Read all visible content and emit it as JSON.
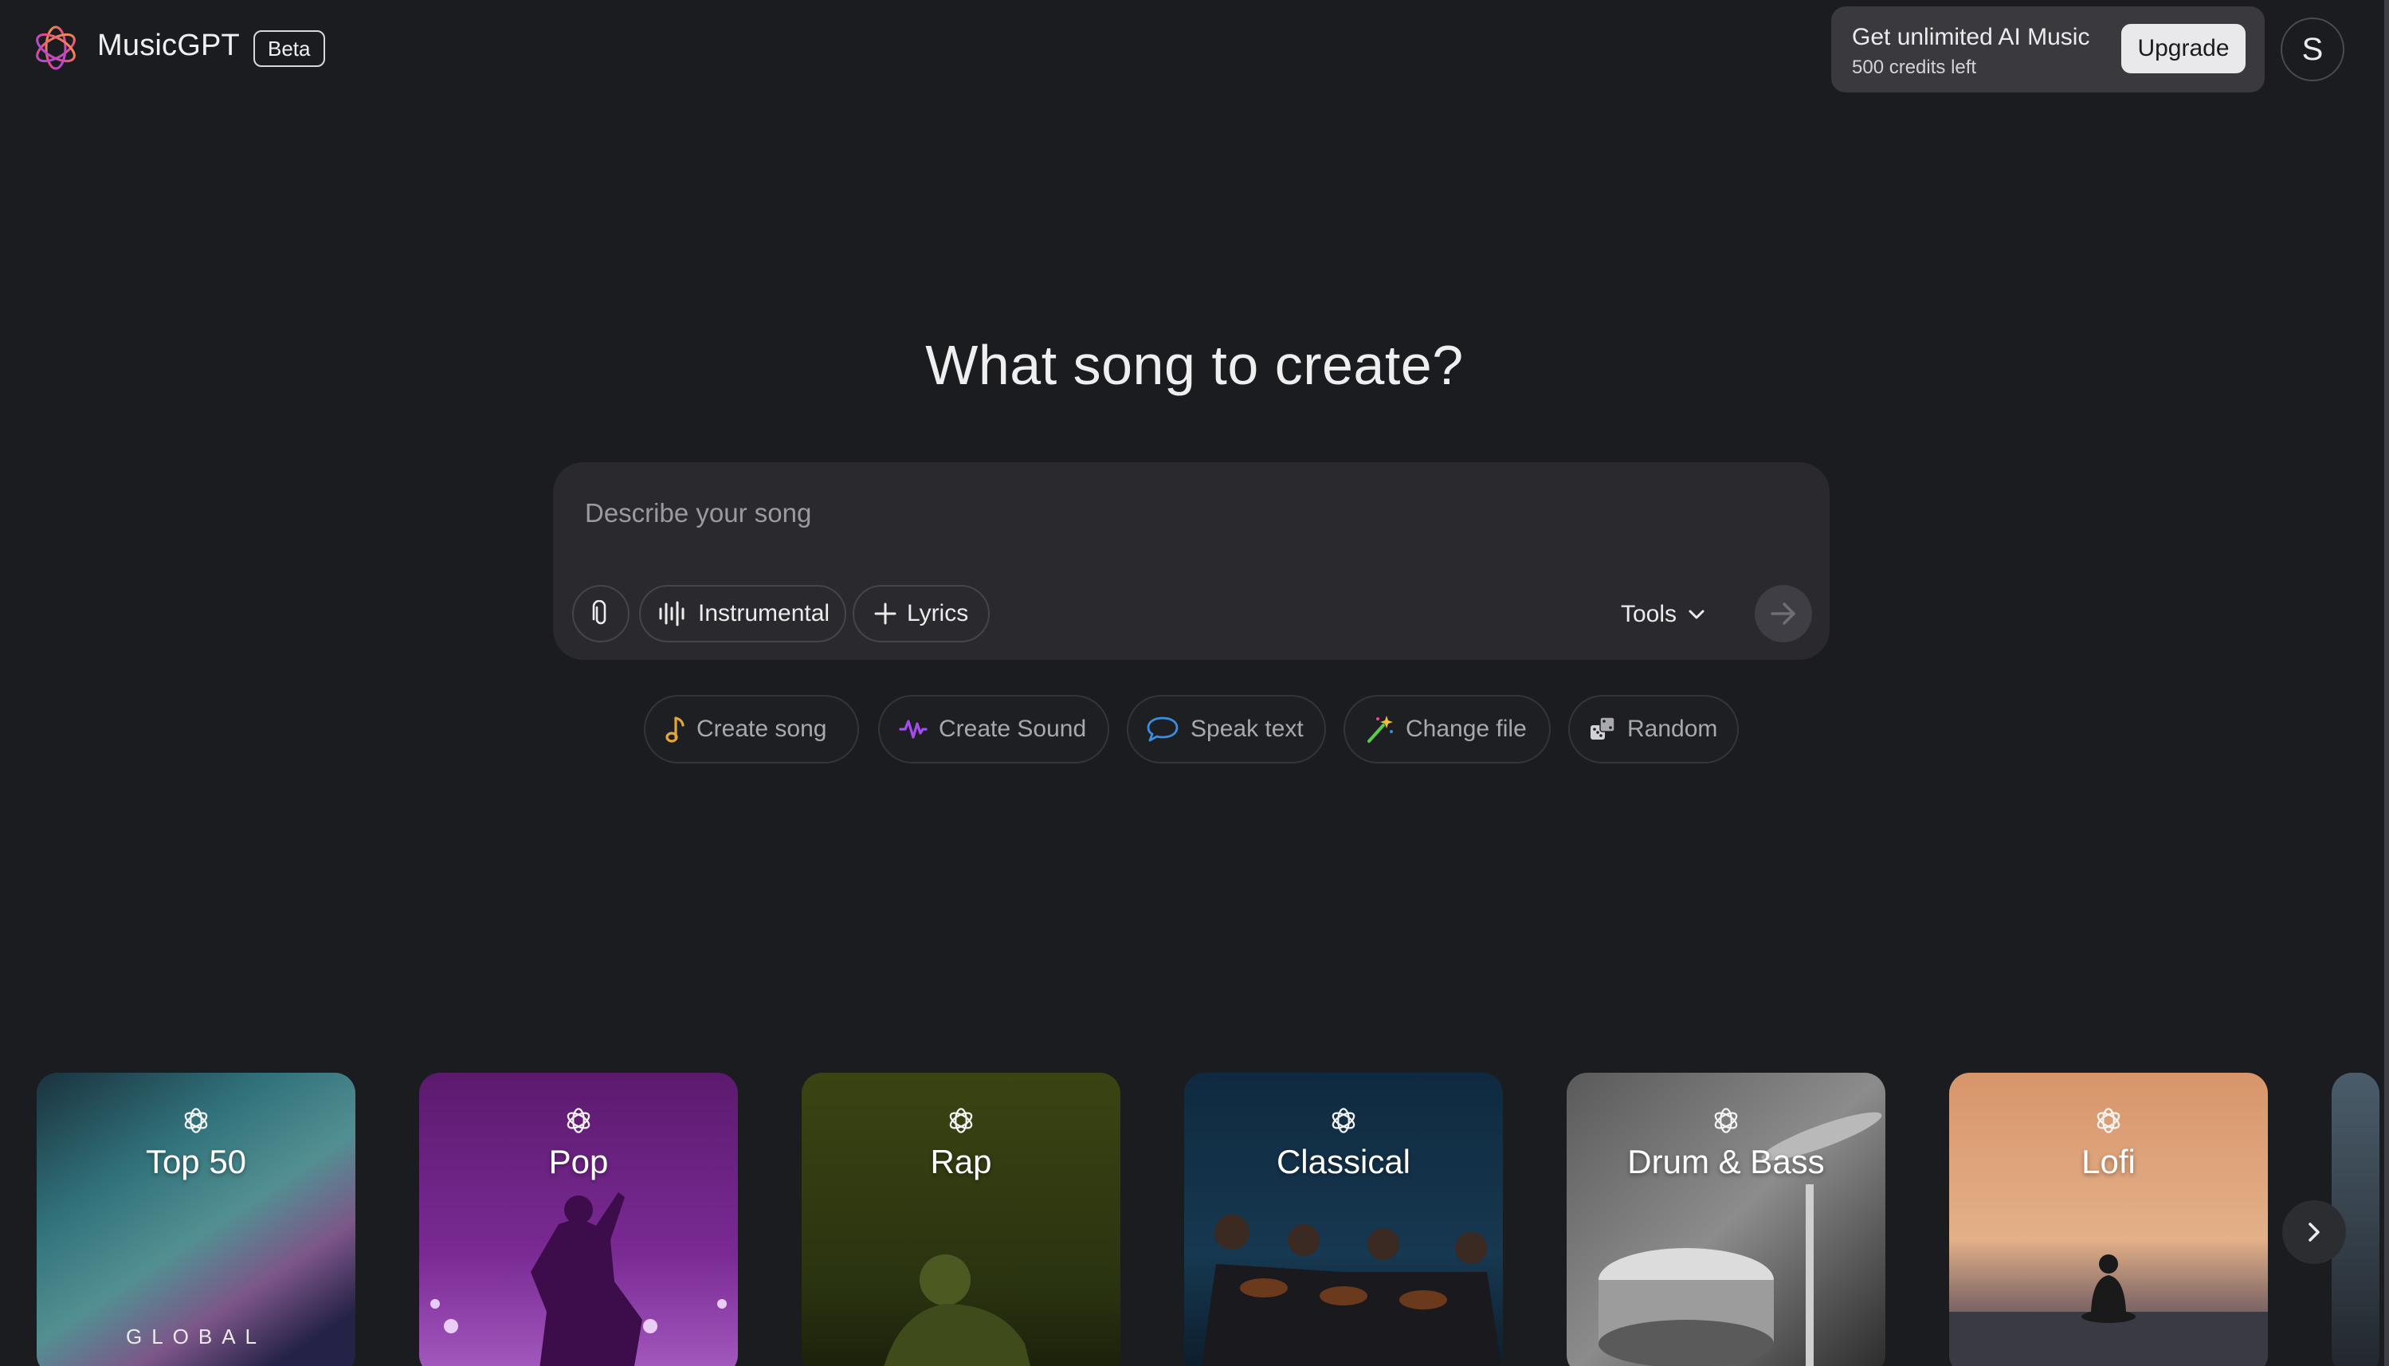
{
  "header": {
    "brand": "MusicGPT",
    "badge": "Beta",
    "upgrade_title": "Get unlimited AI Music",
    "credits": "500 credits left",
    "upgrade_label": "Upgrade",
    "avatar_initial": "S"
  },
  "hero": {
    "title": "What song to create?"
  },
  "prompt": {
    "placeholder": "Describe your song",
    "instrumental_label": "Instrumental",
    "lyrics_label": "Lyrics",
    "tools_label": "Tools"
  },
  "quick_actions": [
    {
      "label": "Create song",
      "icon": "music-note-icon",
      "color": "#e3a63a"
    },
    {
      "label": "Create Sound",
      "icon": "waveform-icon",
      "color": "#a54cf0"
    },
    {
      "label": "Speak text",
      "icon": "speech-bubble-icon",
      "color": "#3b8de0"
    },
    {
      "label": "Change file",
      "icon": "magic-wand-icon",
      "color": "#5cc94c"
    },
    {
      "label": "Random",
      "icon": "dice-icon",
      "color": "#c8c8cc"
    }
  ],
  "genres": [
    {
      "label": "Top 50",
      "sublabel": "GLOBAL"
    },
    {
      "label": "Pop"
    },
    {
      "label": "Rap"
    },
    {
      "label": "Classical"
    },
    {
      "label": "Drum & Bass"
    },
    {
      "label": "Lofi"
    }
  ],
  "colors": {
    "background": "#1b1c20",
    "panel": "#2a2a2e",
    "upgrade_panel": "#3a3a3e"
  }
}
